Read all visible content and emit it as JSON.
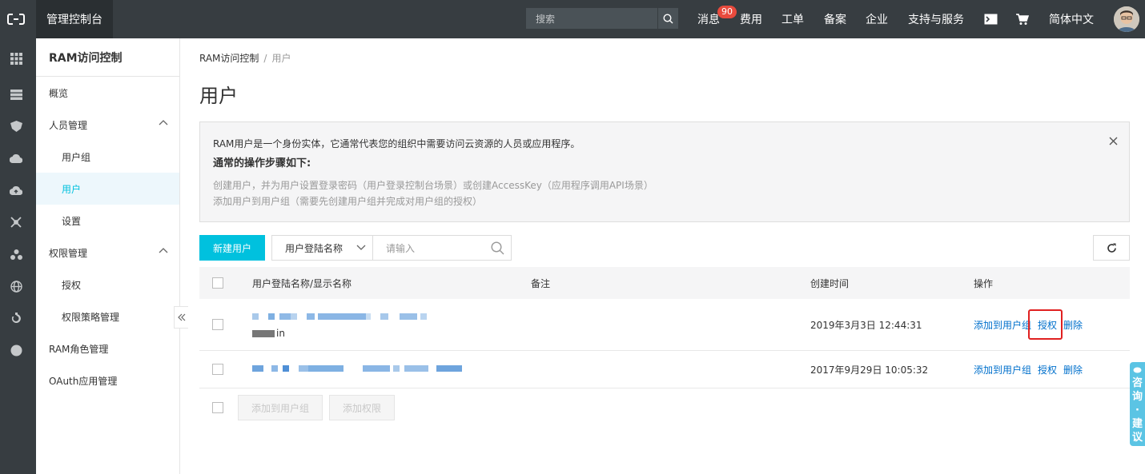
{
  "topbar": {
    "console_title": "管理控制台",
    "search_placeholder": "搜索",
    "nav": [
      "消息",
      "费用",
      "工单",
      "备案",
      "企业",
      "支持与服务"
    ],
    "message_badge": "90",
    "language": "简体中文"
  },
  "sidebar": {
    "title": "RAM访问控制",
    "items": [
      {
        "label": "概览"
      },
      {
        "label": "人员管理"
      },
      {
        "label": "用户组"
      },
      {
        "label": "用户"
      },
      {
        "label": "设置"
      },
      {
        "label": "权限管理"
      },
      {
        "label": "授权"
      },
      {
        "label": "权限策略管理"
      },
      {
        "label": "RAM角色管理"
      },
      {
        "label": "OAuth应用管理"
      }
    ]
  },
  "breadcrumb": {
    "root": "RAM访问控制",
    "sep": "/",
    "current": "用户"
  },
  "page_title": "用户",
  "notice": {
    "line1": "RAM用户是一个身份实体，它通常代表您的组织中需要访问云资源的人员或应用程序。",
    "heading": "通常的操作步骤如下:",
    "step1": "创建用户，并为用户设置登录密码（用户登录控制台场景）或创建AccessKey（应用程序调用API场景）",
    "step2": "添加用户到用户组（需要先创建用户组并完成对用户组的授权）"
  },
  "toolbar": {
    "new_user": "新建用户",
    "filter_field": "用户登陆名称",
    "search_placeholder": "请输入"
  },
  "table": {
    "headers": [
      "用户登陆名称/显示名称",
      "备注",
      "创建时间",
      "操作"
    ],
    "rows": [
      {
        "name_suffix": "in",
        "created": "2019年3月3日 12:44:31",
        "actions": [
          "添加到用户组",
          "授权",
          "删除"
        ]
      },
      {
        "created": "2017年9月29日 10:05:32",
        "actions": [
          "添加到用户组",
          "授权",
          "删除"
        ]
      }
    ]
  },
  "bulk": {
    "add_to_group": "添加到用户组",
    "add_permission": "添加权限"
  },
  "feedback": [
    "咨",
    "询",
    "·",
    "建",
    "议"
  ],
  "colors": {
    "accent": "#00c1de",
    "topbar": "#373d41",
    "link": "#0070cc",
    "highlight": "#e02020"
  }
}
